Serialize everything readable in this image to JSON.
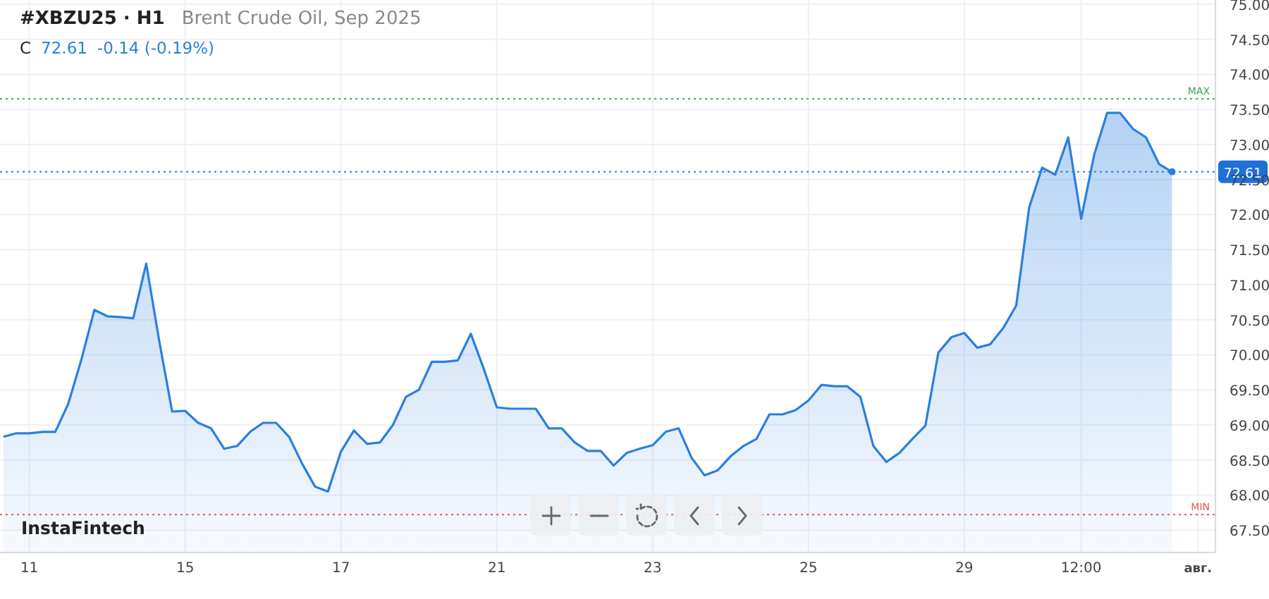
{
  "header": {
    "symbol": "#XBZU25 · H1",
    "name": "Brent Crude Oil, Sep 2025",
    "close_label": "C",
    "close": "72.61",
    "change": "-0.14 (-0.19%)"
  },
  "chart": {
    "chart_data": {
      "type": "area",
      "categories": [
        null,
        null,
        "11",
        null,
        null,
        null,
        null,
        null,
        null,
        null,
        null,
        null,
        null,
        null,
        "15",
        null,
        null,
        null,
        null,
        null,
        null,
        null,
        null,
        null,
        null,
        null,
        "17",
        null,
        null,
        null,
        null,
        null,
        null,
        null,
        null,
        null,
        null,
        null,
        "21",
        null,
        null,
        null,
        null,
        null,
        null,
        null,
        null,
        null,
        null,
        null,
        "23",
        null,
        null,
        null,
        null,
        null,
        null,
        null,
        null,
        null,
        null,
        null,
        "25",
        null,
        null,
        null,
        null,
        null,
        null,
        null,
        null,
        null,
        null,
        null,
        "29",
        null,
        null,
        null,
        null,
        null,
        null,
        null,
        null,
        "12:00",
        null,
        null,
        null,
        null,
        null,
        null,
        null,
        null,
        "авг."
      ],
      "series": [
        {
          "color": "#2a7fde",
          "values": [
            68.83,
            68.88,
            68.88,
            68.9,
            68.9,
            69.3,
            69.93,
            70.64,
            70.55,
            70.54,
            70.52,
            71.3,
            70.2,
            69.19,
            69.2,
            69.03,
            68.95,
            68.66,
            68.7,
            68.9,
            69.03,
            69.03,
            68.83,
            68.45,
            68.12,
            68.05,
            68.62,
            68.92,
            68.73,
            68.75,
            69.0,
            69.4,
            69.5,
            69.9,
            69.9,
            69.92,
            70.3,
            69.8,
            69.25,
            69.23,
            69.23,
            69.23,
            68.95,
            68.95,
            68.75,
            68.63,
            68.63,
            68.42,
            68.6,
            68.66,
            68.71,
            68.9,
            68.95,
            68.53,
            68.28,
            68.35,
            68.55,
            68.7,
            68.8,
            69.15,
            69.15,
            69.21,
            69.35,
            69.57,
            69.55,
            69.55,
            69.4,
            68.7,
            68.47,
            68.6,
            68.8,
            68.99,
            70.03,
            70.25,
            70.31,
            70.1,
            70.15,
            70.38,
            70.7,
            72.1,
            72.67,
            72.57,
            73.1,
            71.94,
            72.85,
            73.45,
            73.45,
            73.22,
            73.1,
            72.72,
            72.61,
            null,
            null
          ]
        }
      ],
      "ylim": [
        67.18,
        75.06
      ],
      "grid": true,
      "yticks": [
        {
          "value": 67.5,
          "label": "67.50"
        },
        {
          "value": 68,
          "label": "68.00"
        },
        {
          "value": 68.5,
          "label": "68.50"
        },
        {
          "value": 69,
          "label": "69.00"
        },
        {
          "value": 69.5,
          "label": "69.50"
        },
        {
          "value": 70,
          "label": "70.00"
        },
        {
          "value": 70.5,
          "label": "70.50"
        },
        {
          "value": 71,
          "label": "71.00"
        },
        {
          "value": 71.5,
          "label": "71.50"
        },
        {
          "value": 72,
          "label": "72.00"
        },
        {
          "value": 72.5,
          "label": "72.50"
        },
        {
          "value": 73,
          "label": "73.00"
        },
        {
          "value": 73.5,
          "label": "73.50"
        },
        {
          "value": 74,
          "label": "74.00"
        },
        {
          "value": 74.5,
          "label": "74.50"
        },
        {
          "value": 75,
          "label": "75.00"
        }
      ],
      "ref_lines": [
        {
          "axis": "y",
          "value": 73.65,
          "label": "MAX",
          "color": "#3aa65a"
        },
        {
          "axis": "y",
          "value": 67.72,
          "label": "MIN",
          "color": "#e05656"
        },
        {
          "axis": "y",
          "value": 72.61,
          "color": "#2a7fde"
        }
      ]
    },
    "last_price_tag": "72.61"
  },
  "logo": "InstaFintech",
  "controls": [
    {
      "kind": "zoom-in"
    },
    {
      "kind": "zoom-out"
    },
    {
      "kind": "reset"
    },
    {
      "kind": "back"
    },
    {
      "kind": "forward"
    }
  ]
}
